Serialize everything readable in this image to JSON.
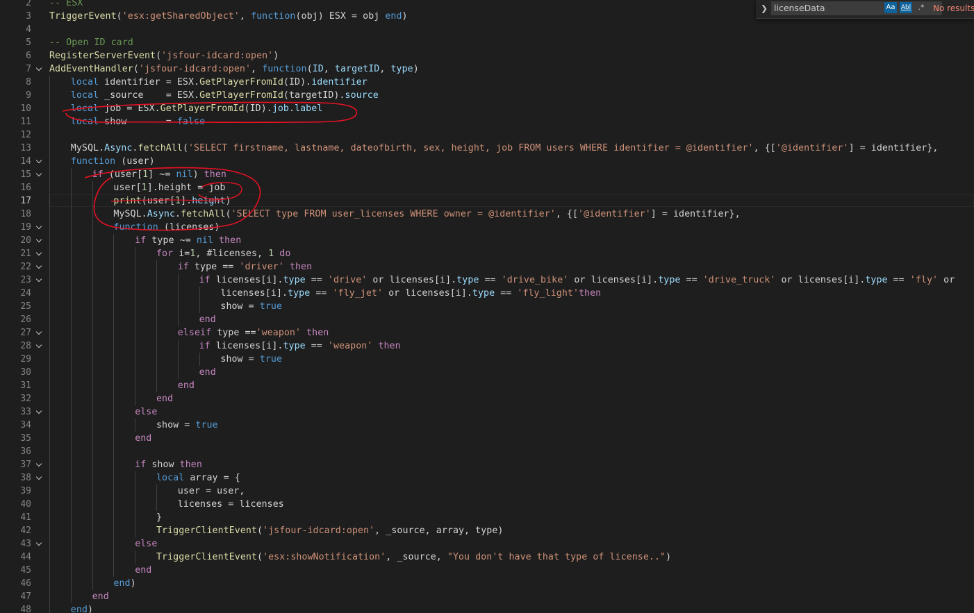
{
  "editor": {
    "current_line": 17,
    "lines": [
      {
        "n": "2",
        "fold": false,
        "indent": 0,
        "tokens": [
          [
            "m",
            "-- ESX"
          ]
        ]
      },
      {
        "n": "3",
        "fold": false,
        "indent": 0,
        "tokens": [
          [
            "f",
            "TriggerEvent"
          ],
          [
            "o",
            "("
          ],
          [
            "s",
            "'esx:getSharedObject'"
          ],
          [
            "o",
            ", "
          ],
          [
            "k",
            "function"
          ],
          [
            "o",
            "(obj) ESX = obj "
          ],
          [
            "k",
            "end"
          ],
          [
            "o",
            ")"
          ]
        ]
      },
      {
        "n": "4",
        "fold": false,
        "indent": 0,
        "tokens": []
      },
      {
        "n": "5",
        "fold": false,
        "indent": 0,
        "tokens": [
          [
            "m",
            "-- Open ID card"
          ]
        ]
      },
      {
        "n": "6",
        "fold": false,
        "indent": 0,
        "tokens": [
          [
            "f",
            "RegisterServerEvent"
          ],
          [
            "o",
            "("
          ],
          [
            "s",
            "'jsfour-idcard:open'"
          ],
          [
            "o",
            ")"
          ]
        ]
      },
      {
        "n": "7",
        "fold": true,
        "indent": 0,
        "tokens": [
          [
            "f",
            "AddEventHandler"
          ],
          [
            "o",
            "("
          ],
          [
            "s",
            "'jsfour-idcard:open'"
          ],
          [
            "o",
            ", "
          ],
          [
            "k",
            "function"
          ],
          [
            "o",
            "("
          ],
          [
            "v",
            "ID"
          ],
          [
            "o",
            ", "
          ],
          [
            "v",
            "targetID"
          ],
          [
            "o",
            ", "
          ],
          [
            "v",
            "type"
          ],
          [
            "o",
            ")"
          ]
        ]
      },
      {
        "n": "8",
        "fold": false,
        "indent": 1,
        "tokens": [
          [
            "k",
            "local"
          ],
          [
            "o",
            " identifier = ESX."
          ],
          [
            "f",
            "GetPlayerFromId"
          ],
          [
            "o",
            "(ID)."
          ],
          [
            "v",
            "identifier"
          ]
        ]
      },
      {
        "n": "9",
        "fold": false,
        "indent": 1,
        "tokens": [
          [
            "k",
            "local"
          ],
          [
            "o",
            " _source    = ESX."
          ],
          [
            "f",
            "GetPlayerFromId"
          ],
          [
            "o",
            "(targetID)."
          ],
          [
            "v",
            "source"
          ]
        ]
      },
      {
        "n": "10",
        "fold": false,
        "indent": 1,
        "tokens": [
          [
            "k",
            "local"
          ],
          [
            "o",
            " job = ESX."
          ],
          [
            "f",
            "GetPlayerFromId"
          ],
          [
            "o",
            "(ID)."
          ],
          [
            "v",
            "job"
          ],
          [
            "o",
            "."
          ],
          [
            "v",
            "label"
          ]
        ]
      },
      {
        "n": "11",
        "fold": false,
        "indent": 1,
        "tokens": [
          [
            "k",
            "local"
          ],
          [
            "o",
            " show       = "
          ],
          [
            "k",
            "false"
          ]
        ]
      },
      {
        "n": "12",
        "fold": false,
        "indent": 1,
        "tokens": []
      },
      {
        "n": "13",
        "fold": false,
        "indent": 1,
        "tokens": [
          [
            "o",
            "MySQL."
          ],
          [
            "v",
            "Async"
          ],
          [
            "o",
            "."
          ],
          [
            "f",
            "fetchAll"
          ],
          [
            "o",
            "("
          ],
          [
            "s",
            "'SELECT firstname, lastname, dateofbirth, sex, height, job FROM users WHERE identifier = @identifier'"
          ],
          [
            "o",
            ", {["
          ],
          [
            "s",
            "'@identifier'"
          ],
          [
            "o",
            "] = identifier},"
          ]
        ]
      },
      {
        "n": "14",
        "fold": true,
        "indent": 1,
        "tokens": [
          [
            "k",
            "function"
          ],
          [
            "o",
            " (user)"
          ]
        ]
      },
      {
        "n": "15",
        "fold": true,
        "indent": 2,
        "tokens": [
          [
            "c",
            "if"
          ],
          [
            "o",
            " (user["
          ],
          [
            "n",
            "1"
          ],
          [
            "o",
            "] ~= "
          ],
          [
            "k",
            "nil"
          ],
          [
            "o",
            ") "
          ],
          [
            "c",
            "then"
          ]
        ]
      },
      {
        "n": "16",
        "fold": false,
        "indent": 3,
        "tokens": [
          [
            "o",
            "user["
          ],
          [
            "n",
            "1"
          ],
          [
            "o",
            "].height = job"
          ]
        ]
      },
      {
        "n": "17",
        "fold": false,
        "indent": 3,
        "tokens": [
          [
            "f",
            "print"
          ],
          [
            "o",
            "(user["
          ],
          [
            "n",
            "1"
          ],
          [
            "o",
            "]."
          ],
          [
            "v",
            "height"
          ],
          [
            "o",
            ")"
          ]
        ]
      },
      {
        "n": "18",
        "fold": false,
        "indent": 3,
        "tokens": [
          [
            "o",
            "MySQL."
          ],
          [
            "v",
            "Async"
          ],
          [
            "o",
            "."
          ],
          [
            "f",
            "fetchAll"
          ],
          [
            "o",
            "("
          ],
          [
            "s",
            "'SELECT type FROM user_licenses WHERE owner = @identifier'"
          ],
          [
            "o",
            ", {["
          ],
          [
            "s",
            "'@identifier'"
          ],
          [
            "o",
            "] = identifier},"
          ]
        ]
      },
      {
        "n": "19",
        "fold": true,
        "indent": 3,
        "tokens": [
          [
            "k",
            "function"
          ],
          [
            "o",
            " (licenses)"
          ]
        ]
      },
      {
        "n": "20",
        "fold": true,
        "indent": 4,
        "tokens": [
          [
            "c",
            "if"
          ],
          [
            "o",
            " type ~= "
          ],
          [
            "k",
            "nil"
          ],
          [
            "o",
            " "
          ],
          [
            "c",
            "then"
          ]
        ]
      },
      {
        "n": "21",
        "fold": true,
        "indent": 5,
        "tokens": [
          [
            "c",
            "for"
          ],
          [
            "o",
            " i="
          ],
          [
            "n",
            "1"
          ],
          [
            "o",
            ", #licenses, "
          ],
          [
            "n",
            "1"
          ],
          [
            "o",
            " "
          ],
          [
            "c",
            "do"
          ]
        ]
      },
      {
        "n": "22",
        "fold": true,
        "indent": 6,
        "tokens": [
          [
            "c",
            "if"
          ],
          [
            "o",
            " type == "
          ],
          [
            "s",
            "'driver'"
          ],
          [
            "o",
            " "
          ],
          [
            "c",
            "then"
          ]
        ]
      },
      {
        "n": "23",
        "fold": true,
        "indent": 7,
        "tokens": [
          [
            "c",
            "if"
          ],
          [
            "o",
            " licenses[i]."
          ],
          [
            "v",
            "type"
          ],
          [
            "o",
            " == "
          ],
          [
            "s",
            "'drive'"
          ],
          [
            "o",
            " or licenses[i]."
          ],
          [
            "v",
            "type"
          ],
          [
            "o",
            " == "
          ],
          [
            "s",
            "'drive_bike'"
          ],
          [
            "o",
            " or licenses[i]."
          ],
          [
            "v",
            "type"
          ],
          [
            "o",
            " == "
          ],
          [
            "s",
            "'drive_truck'"
          ],
          [
            "o",
            " or licenses[i]."
          ],
          [
            "v",
            "type"
          ],
          [
            "o",
            " == "
          ],
          [
            "s",
            "'fly'"
          ],
          [
            "o",
            " or"
          ]
        ]
      },
      {
        "n": "24",
        "fold": false,
        "indent": 8,
        "tokens": [
          [
            "o",
            "licenses[i]."
          ],
          [
            "v",
            "type"
          ],
          [
            "o",
            " == "
          ],
          [
            "s",
            "'fly_jet'"
          ],
          [
            "o",
            " or licenses[i]."
          ],
          [
            "v",
            "type"
          ],
          [
            "o",
            " == "
          ],
          [
            "s",
            "'fly_light'"
          ],
          [
            "c",
            "then"
          ]
        ]
      },
      {
        "n": "25",
        "fold": false,
        "indent": 8,
        "tokens": [
          [
            "o",
            "show = "
          ],
          [
            "k",
            "true"
          ]
        ]
      },
      {
        "n": "26",
        "fold": false,
        "indent": 7,
        "tokens": [
          [
            "c",
            "end"
          ]
        ]
      },
      {
        "n": "27",
        "fold": true,
        "indent": 6,
        "tokens": [
          [
            "c",
            "elseif"
          ],
          [
            "o",
            " type =="
          ],
          [
            "s",
            "'weapon'"
          ],
          [
            "o",
            " "
          ],
          [
            "c",
            "then"
          ]
        ]
      },
      {
        "n": "28",
        "fold": true,
        "indent": 7,
        "tokens": [
          [
            "c",
            "if"
          ],
          [
            "o",
            " licenses[i]."
          ],
          [
            "v",
            "type"
          ],
          [
            "o",
            " == "
          ],
          [
            "s",
            "'weapon'"
          ],
          [
            "o",
            " "
          ],
          [
            "c",
            "then"
          ]
        ]
      },
      {
        "n": "29",
        "fold": false,
        "indent": 8,
        "tokens": [
          [
            "o",
            "show = "
          ],
          [
            "k",
            "true"
          ]
        ]
      },
      {
        "n": "30",
        "fold": false,
        "indent": 7,
        "tokens": [
          [
            "c",
            "end"
          ]
        ]
      },
      {
        "n": "31",
        "fold": false,
        "indent": 6,
        "tokens": [
          [
            "c",
            "end"
          ]
        ]
      },
      {
        "n": "32",
        "fold": false,
        "indent": 5,
        "tokens": [
          [
            "c",
            "end"
          ]
        ]
      },
      {
        "n": "33",
        "fold": true,
        "indent": 4,
        "tokens": [
          [
            "c",
            "else"
          ]
        ]
      },
      {
        "n": "34",
        "fold": false,
        "indent": 5,
        "tokens": [
          [
            "o",
            "show = "
          ],
          [
            "k",
            "true"
          ]
        ]
      },
      {
        "n": "35",
        "fold": false,
        "indent": 4,
        "tokens": [
          [
            "c",
            "end"
          ]
        ]
      },
      {
        "n": "36",
        "fold": false,
        "indent": 4,
        "tokens": []
      },
      {
        "n": "37",
        "fold": true,
        "indent": 4,
        "tokens": [
          [
            "c",
            "if"
          ],
          [
            "o",
            " show "
          ],
          [
            "c",
            "then"
          ]
        ]
      },
      {
        "n": "38",
        "fold": true,
        "indent": 5,
        "tokens": [
          [
            "k",
            "local"
          ],
          [
            "o",
            " array = {"
          ]
        ]
      },
      {
        "n": "39",
        "fold": false,
        "indent": 6,
        "tokens": [
          [
            "o",
            "user = user,"
          ]
        ]
      },
      {
        "n": "40",
        "fold": false,
        "indent": 6,
        "tokens": [
          [
            "o",
            "licenses = licenses"
          ]
        ]
      },
      {
        "n": "41",
        "fold": false,
        "indent": 5,
        "tokens": [
          [
            "o",
            "}"
          ]
        ]
      },
      {
        "n": "42",
        "fold": false,
        "indent": 5,
        "tokens": [
          [
            "f",
            "TriggerClientEvent"
          ],
          [
            "o",
            "("
          ],
          [
            "s",
            "'jsfour-idcard:open'"
          ],
          [
            "o",
            ", _source, array, type)"
          ]
        ]
      },
      {
        "n": "43",
        "fold": true,
        "indent": 4,
        "tokens": [
          [
            "c",
            "else"
          ]
        ]
      },
      {
        "n": "44",
        "fold": false,
        "indent": 5,
        "tokens": [
          [
            "f",
            "TriggerClientEvent"
          ],
          [
            "o",
            "("
          ],
          [
            "s",
            "'esx:showNotification'"
          ],
          [
            "o",
            ", _source, "
          ],
          [
            "s",
            "\"You don't have that type of license..\""
          ],
          [
            "o",
            ")"
          ]
        ]
      },
      {
        "n": "45",
        "fold": false,
        "indent": 4,
        "tokens": [
          [
            "c",
            "end"
          ]
        ]
      },
      {
        "n": "46",
        "fold": false,
        "indent": 3,
        "tokens": [
          [
            "k",
            "end"
          ],
          [
            "o",
            ")"
          ]
        ]
      },
      {
        "n": "47",
        "fold": false,
        "indent": 2,
        "tokens": [
          [
            "c",
            "end"
          ]
        ]
      },
      {
        "n": "48",
        "fold": false,
        "indent": 1,
        "tokens": [
          [
            "k",
            "end"
          ],
          [
            "o",
            ")"
          ]
        ]
      }
    ]
  },
  "find_widget": {
    "toggle_icon": "chevron-right-icon",
    "query": "licenseData",
    "match_case_label": "Aa",
    "whole_word_label": "Abl",
    "regex_label": ".*",
    "result_text": "No results",
    "result_color": "#f48771"
  },
  "colors": {
    "background": "#1e1e1e",
    "keyword": "#569cd6",
    "control": "#c586c0",
    "string": "#ce9178",
    "comment": "#6a9955",
    "function": "#dcdcaa",
    "property": "#9cdcfe",
    "number": "#b5cea8",
    "annotation": "#e81123"
  }
}
